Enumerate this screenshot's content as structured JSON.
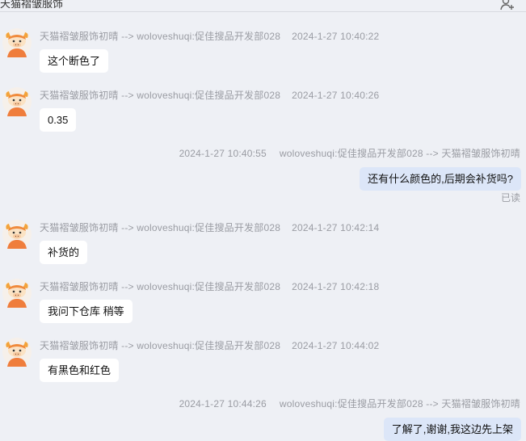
{
  "header": {
    "title": "天猫褶皱服饰",
    "icon": "add-contact-icon"
  },
  "messages": [
    {
      "direction": "in",
      "from": "天猫褶皱服饰初晴 --> woloveshuqi:促佳搜品开发部028",
      "time": "2024-1-27 10:40:22",
      "text": "这个断色了"
    },
    {
      "direction": "in",
      "from": "天猫褶皱服饰初晴 --> woloveshuqi:促佳搜品开发部028",
      "time": "2024-1-27 10:40:26",
      "text": "0.35"
    },
    {
      "direction": "out",
      "from": "woloveshuqi:促佳搜品开发部028 --> 天猫褶皱服饰初晴",
      "time": "2024-1-27 10:40:55",
      "text": "还有什么颜色的,后期会补货吗?",
      "status": "已读"
    },
    {
      "direction": "in",
      "from": "天猫褶皱服饰初晴 --> woloveshuqi:促佳搜品开发部028",
      "time": "2024-1-27 10:42:14",
      "text": "补货的"
    },
    {
      "direction": "in",
      "from": "天猫褶皱服饰初晴 --> woloveshuqi:促佳搜品开发部028",
      "time": "2024-1-27 10:42:18",
      "text": "我问下仓库 稍等"
    },
    {
      "direction": "in",
      "from": "天猫褶皱服饰初晴 --> woloveshuqi:促佳搜品开发部028",
      "time": "2024-1-27 10:44:02",
      "text": "有黑色和红色"
    },
    {
      "direction": "out",
      "from": "woloveshuqi:促佳搜品开发部028 --> 天猫褶皱服饰初晴",
      "time": "2024-1-27 10:44:26",
      "text": "了解了,谢谢,我这边先上架"
    }
  ],
  "colors": {
    "background": "#eef0f5",
    "incoming_bubble": "#ffffff",
    "outgoing_bubble": "#dce6f8",
    "meta_text": "#9a9ca3",
    "avatar_face": "#fbe3c4",
    "avatar_body": "#ef7d3c",
    "avatar_horn": "#f3a33a"
  }
}
